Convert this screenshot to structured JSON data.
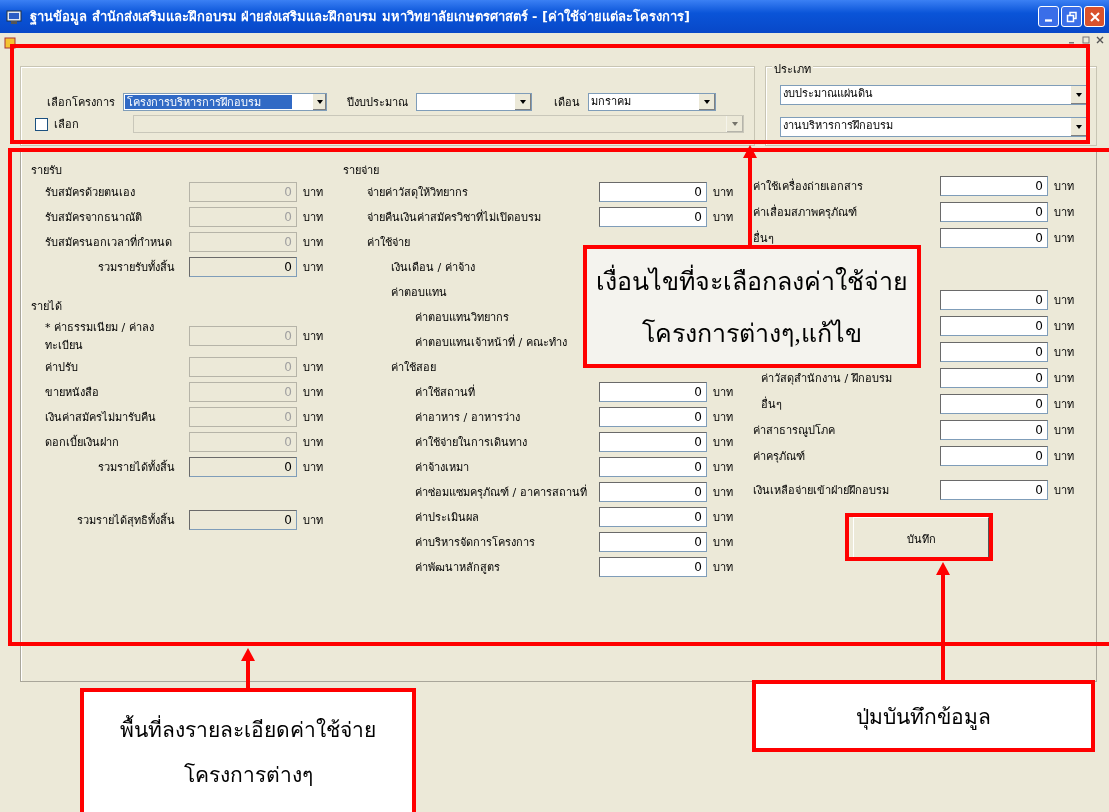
{
  "window": {
    "title": "ฐานข้อมูล สำนักส่งเสริมและฝึกอบรม ฝ่ายส่งเสริมและฝึกอบรม มหาวิทยาลัยเกษตรศาสตร์ - [ค่าใช้จ่ายแต่ละโครงการ]"
  },
  "selectors": [
    {
      "label": "เลือกโครงการ",
      "value": "โครงการบริหารการฝึกอบรม",
      "highlighted": true
    },
    {
      "label": "ปีงบประมาณ",
      "highlighted": false
    },
    {
      "label": "เดือน",
      "value": "มกราคม",
      "highlighted": false
    }
  ],
  "select_option": {
    "label": "เลือก",
    "checked": false,
    "combo_disabled": true
  },
  "type_group": {
    "title": "ประเภท",
    "combos": [
      "งบประมาณแผ่นดิน",
      "งานบริหารการฝึกอบรม"
    ]
  },
  "details": {
    "columns": [
      [
        {
          "label": "รายรับ",
          "children": [
            {
              "kind": "field",
              "label": "รับสมัครด้วยตนเอง",
              "value": "0",
              "unit": "บาท",
              "disabled": true
            },
            {
              "kind": "field",
              "label": "รับสมัครจากธนาณัติ",
              "value": "0",
              "unit": "บาท",
              "disabled": true
            },
            {
              "kind": "field",
              "label": "รับสมัครนอกเวลาที่กำหนด",
              "value": "0",
              "unit": "บาท",
              "disabled": true
            },
            {
              "kind": "total",
              "label": "รวมรายรับทั้งสิ้น",
              "value": "0",
              "unit": "บาท",
              "disabled": false
            }
          ]
        },
        {
          "label": "รายได้",
          "children": [
            {
              "kind": "field",
              "label": "* ค่าธรรมเนียม / ค่าลงทะเบียน",
              "value": "0",
              "unit": "บาท",
              "disabled": true
            },
            {
              "kind": "field",
              "label": "ค่าปรับ",
              "value": "0",
              "unit": "บาท",
              "disabled": true
            },
            {
              "kind": "field",
              "label": "ขายหนังสือ",
              "value": "0",
              "unit": "บาท",
              "disabled": true
            },
            {
              "kind": "field",
              "label": "เงินค่าสมัครไม่มารับคืน",
              "value": "0",
              "unit": "บาท",
              "disabled": true
            },
            {
              "kind": "field",
              "label": "ดอกเบี้ยเงินฝาก",
              "value": "0",
              "unit": "บาท",
              "disabled": true
            },
            {
              "kind": "total",
              "label": "รวมรายได้ทั้งสิ้น",
              "value": "0",
              "unit": "บาท",
              "disabled": false
            }
          ]
        },
        {
          "kind": "grand",
          "label": "รวมรายได้สุทธิทั้งสิ้น",
          "value": "0",
          "unit": "บาท",
          "disabled": false
        }
      ],
      [
        {
          "label": "รายจ่าย",
          "children": [
            {
              "kind": "field",
              "label": "จ่ายค่าวัสดุให้วิทยากร",
              "value": "0",
              "unit": "บาท",
              "disabled": false
            },
            {
              "kind": "field",
              "label": "จ่ายคืนเงินค่าสมัครวิชาที่ไม่เปิดอบรม",
              "value": "0",
              "unit": "บาท",
              "disabled": false
            },
            {
              "label": "ค่าใช้จ่าย",
              "children": [
                {
                  "label": "เงินเดือน / ค่าจ้าง"
                },
                {
                  "label": "ค่าตอบแทน",
                  "children": [
                    {
                      "label": "ค่าตอบแทนวิทยากร"
                    },
                    {
                      "label": "ค่าตอบแทนเจ้าหน้าที่ / คณะทำง"
                    }
                  ]
                },
                {
                  "label": "ค่าใช้สอย",
                  "children": [
                    {
                      "kind": "field",
                      "label": "ค่าใช้สถานที่",
                      "value": "0",
                      "unit": "บาท",
                      "disabled": false
                    },
                    {
                      "kind": "field",
                      "label": "ค่าอาหาร / อาหารว่าง",
                      "value": "0",
                      "unit": "บาท",
                      "disabled": false
                    },
                    {
                      "kind": "field",
                      "label": "ค่าใช้จ่ายในการเดินทาง",
                      "value": "0",
                      "unit": "บาท",
                      "disabled": false
                    },
                    {
                      "kind": "field",
                      "label": "ค่าจ้างเหมา",
                      "value": "0",
                      "unit": "บาท",
                      "disabled": false
                    },
                    {
                      "kind": "field",
                      "label": "ค่าซ่อมแซมครุภัณฑ์ / อาคารสถานที่",
                      "value": "0",
                      "unit": "บาท",
                      "disabled": false
                    },
                    {
                      "kind": "field",
                      "label": "ค่าประเมินผล",
                      "value": "0",
                      "unit": "บาท",
                      "disabled": false
                    },
                    {
                      "kind": "field",
                      "label": "ค่าบริหารจัดการโครงการ",
                      "value": "0",
                      "unit": "บาท",
                      "disabled": false
                    },
                    {
                      "kind": "field",
                      "label": "ค่าพัฒนาหลักสูตร",
                      "value": "0",
                      "unit": "บาท",
                      "disabled": false
                    }
                  ]
                }
              ]
            }
          ]
        }
      ],
      [
        {
          "kind": "field",
          "label": "ค่าใช้เครื่องถ่ายเอกสาร",
          "value": "0",
          "unit": "บาท",
          "disabled": false
        },
        {
          "kind": "field",
          "label": "ค่าเสื่อมสภาพครุภัณฑ์",
          "value": "0",
          "unit": "บาท",
          "disabled": false
        },
        {
          "kind": "field",
          "label": "อื่นๆ",
          "value": "0",
          "unit": "บาท",
          "disabled": false
        },
        {
          "children": [
            {
              "kind": "field",
              "value": "0",
              "unit": "บาท",
              "disabled": false
            },
            {
              "kind": "field",
              "value": "0",
              "unit": "บาท",
              "disabled": false
            },
            {
              "kind": "field",
              "value": "0",
              "unit": "บาท",
              "disabled": false
            },
            {
              "kind": "field",
              "label": "ค่าวัสดุสำนักงาน / ฝึกอบรม",
              "value": "0",
              "unit": "บาท",
              "disabled": false
            },
            {
              "kind": "field",
              "label": "อื่นๆ",
              "value": "0",
              "unit": "บาท",
              "disabled": false
            }
          ]
        },
        {
          "kind": "field",
          "label": "ค่าสาธารณูปโภค",
          "value": "0",
          "unit": "บาท",
          "disabled": false
        },
        {
          "kind": "field",
          "label": "ค่าครุภัณฑ์",
          "value": "0",
          "unit": "บาท",
          "disabled": false
        },
        {
          "kind": "grand",
          "label": "เงินเหลือจ่ายเข้าฝ่ายฝึกอบรม",
          "value": "0",
          "unit": "บาท",
          "disabled": false
        }
      ]
    ],
    "save_button": "บันทึก"
  },
  "annotations": [
    {
      "kind": "condition",
      "lines": [
        "เงื่อนไขที่จะเลือกลงค่าใช้จ่าย",
        "โครงการต่างๆ,แก้ไข"
      ]
    },
    {
      "kind": "detail_area",
      "lines": [
        "พื้นที่ลงรายละเอียดค่าใช้จ่าย",
        "โครงการต่างๆ"
      ]
    },
    {
      "kind": "save",
      "lines": [
        "ปุ่มบันทึกข้อมูล"
      ]
    }
  ]
}
